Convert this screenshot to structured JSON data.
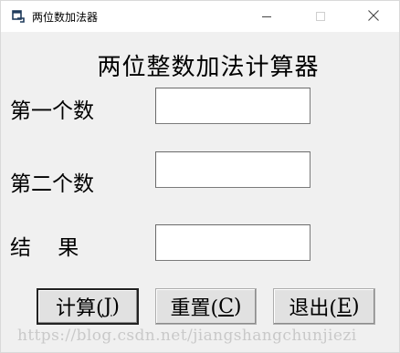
{
  "window": {
    "title": "两位数加法器"
  },
  "heading": "两位整数加法计算器",
  "labels": {
    "first": "第一个数",
    "second": "第二个数",
    "result": "结    果"
  },
  "inputs": {
    "first_value": "",
    "second_value": "",
    "result_value": ""
  },
  "buttons": {
    "calc": {
      "text": "计算(",
      "key": "J",
      "close": ")"
    },
    "reset": {
      "text": "重置(",
      "key": "C",
      "close": ")"
    },
    "exit": {
      "text": "退出(",
      "key": "E",
      "close": ")"
    }
  },
  "watermark": "https://blog.csdn.net/jiangshangchunjiezi",
  "icons": {
    "app": "app-window-icon",
    "minimize": "minimize-icon",
    "maximize": "maximize-icon",
    "close": "close-icon"
  }
}
